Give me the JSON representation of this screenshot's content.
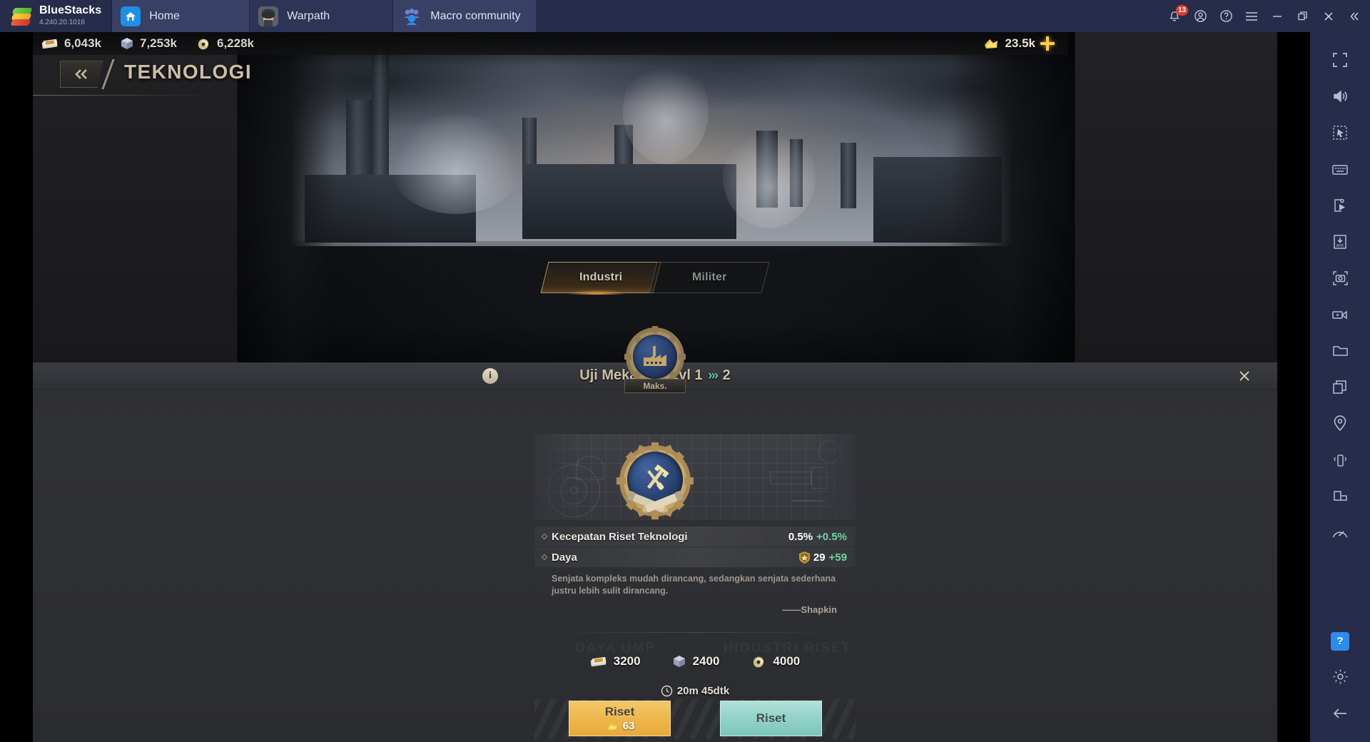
{
  "titlebar": {
    "brand": "BlueStacks",
    "version": "4.240.20.1016",
    "tabs": [
      {
        "label": "Home",
        "icon": "home-icon"
      },
      {
        "label": "Warpath",
        "icon": "warpath-app-icon"
      },
      {
        "label": "Macro community",
        "icon": "macro-community-icon"
      }
    ],
    "notification_count": "13",
    "controls": [
      "notifications-bell-icon",
      "account-icon",
      "help-circle-icon",
      "menu-icon",
      "minimize-icon",
      "maximize-icon",
      "close-icon",
      "collapse-sidebar-icon"
    ]
  },
  "game": {
    "resources": [
      {
        "icon": "cash-icon",
        "value": "6,043k"
      },
      {
        "icon": "steel-icon",
        "value": "7,253k"
      },
      {
        "icon": "oil-icon",
        "value": "6,228k"
      }
    ],
    "gold": {
      "icon": "gold-icon",
      "value": "23.5k",
      "add_label": "+"
    },
    "header": {
      "back_label": "«",
      "title": "TEKNOLOGI"
    },
    "category_tabs": [
      {
        "label": "Industri",
        "active": true
      },
      {
        "label": "Militer",
        "active": false
      }
    ],
    "tech_node": {
      "label": "Maks.",
      "icon": "factory-badge-icon"
    },
    "panel": {
      "info_icon": "info-icon",
      "title_name": "Uji Mekanika Lvl 1",
      "title_arrows": "»›",
      "title_next": "2",
      "close_icon": "close-icon",
      "badge_icon": "hammer-tools-gear-badge-icon",
      "stats": [
        {
          "name": "Kecepatan Riset Teknologi",
          "base": "0.5%",
          "delta": "+0.5%",
          "has_shield": false
        },
        {
          "name": "Daya",
          "base": "29",
          "delta": "+59",
          "has_shield": true
        }
      ],
      "quote": "Senjata kompleks mudah dirancang, sedangkan senjata sederhana justru lebih sulit dirancang.",
      "quote_author": "——Shapkin",
      "ghost_labels": [
        "DAYA UMP",
        "INDUSTRI RISET"
      ],
      "costs": [
        {
          "icon": "cash-icon",
          "value": "3200"
        },
        {
          "icon": "steel-icon",
          "value": "2400"
        },
        {
          "icon": "oil-icon",
          "value": "4000"
        }
      ],
      "time": {
        "icon": "clock-icon",
        "value": "20m 45dtk"
      },
      "buttons": {
        "instant": {
          "label": "Riset",
          "price": "63",
          "price_icon": "gold-icon"
        },
        "normal": {
          "label": "Riset"
        }
      }
    }
  },
  "sidebar": {
    "items": [
      "fullscreen-icon",
      "volume-icon",
      "multi-pointer-icon",
      "keyboard-icon",
      "macro-icon",
      "apk-install-icon",
      "screenshot-icon",
      "record-video-icon",
      "folder-icon",
      "multi-instance-icon",
      "location-icon",
      "shake-icon",
      "rotate-screen-icon",
      "performance-icon"
    ],
    "bottom_items": [
      "help-icon",
      "settings-gear-icon",
      "back-arrow-icon"
    ],
    "help_label": "?"
  },
  "colors": {
    "bluestacks_bar": "#262c4a",
    "accent_gold": "#eeb94e",
    "accent_teal": "#93d2c8",
    "positive_green": "#69d6a4",
    "title_tan": "#cbbfa6"
  }
}
